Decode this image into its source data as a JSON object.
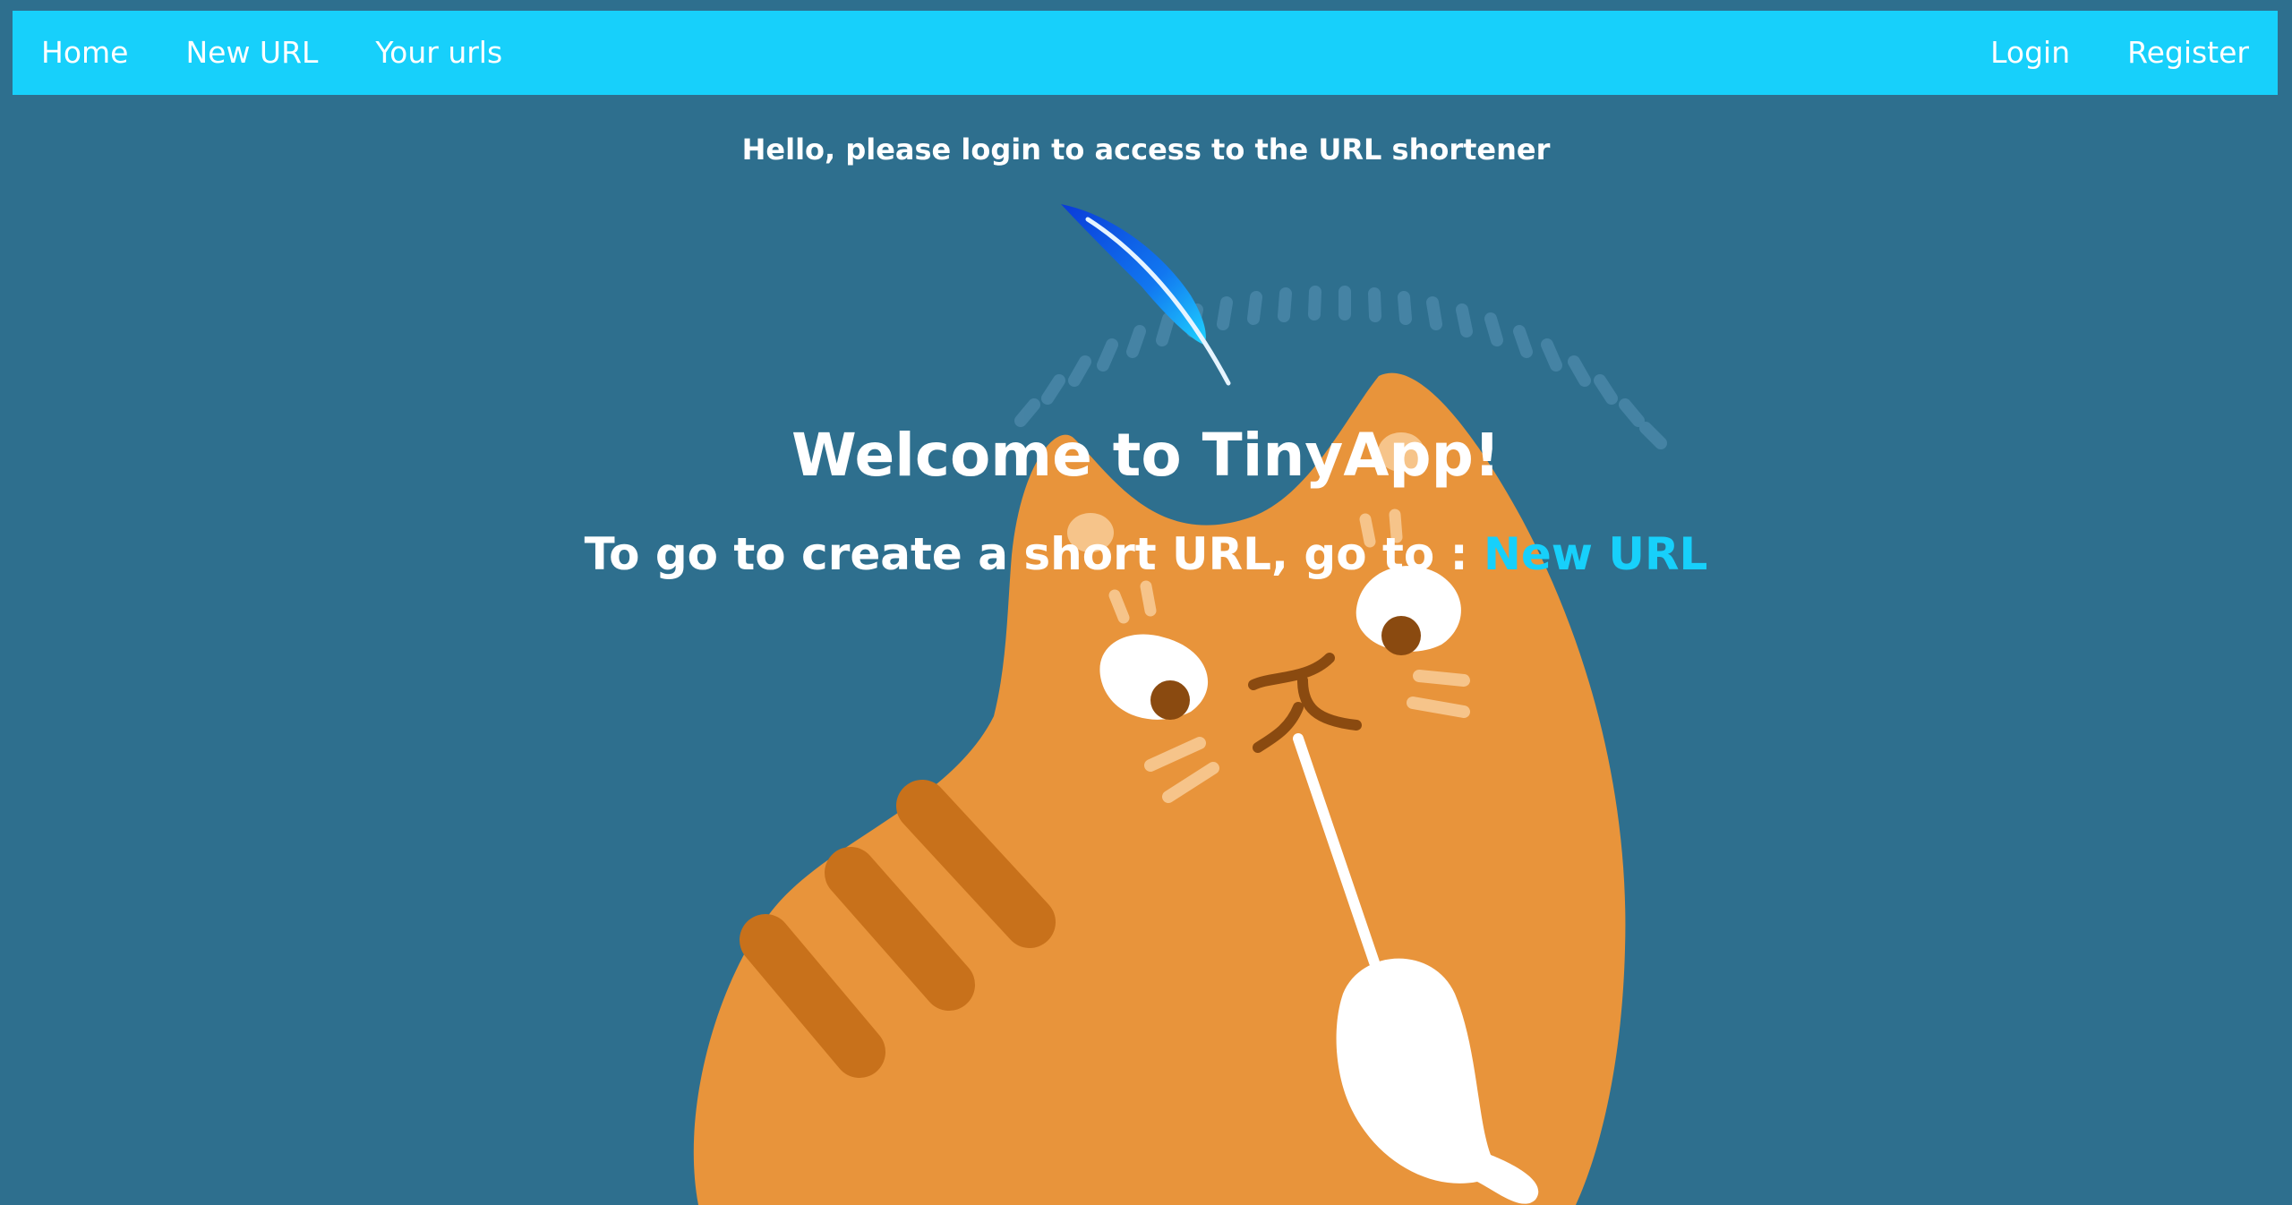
{
  "navbar": {
    "left_links": [
      "Home",
      "New URL",
      "Your urls"
    ],
    "right_links": [
      "Login",
      "Register"
    ]
  },
  "main": {
    "greeting": "Hello, please login to access to the URL shortener",
    "title": "Welcome to TinyApp!",
    "instruction_text": "To go to create a short URL, go to : ",
    "instruction_link": "New URL"
  },
  "colors": {
    "background": "#2e6f8e",
    "navbar": "#17d0fb",
    "link_accent": "#17d0fb",
    "cat_body": "#e8943b",
    "cat_stripes": "#c8711b"
  },
  "illustration": {
    "subject": "orange cat holding a toy with a feather",
    "icons": [
      "feather-icon",
      "cat-illustration"
    ]
  }
}
